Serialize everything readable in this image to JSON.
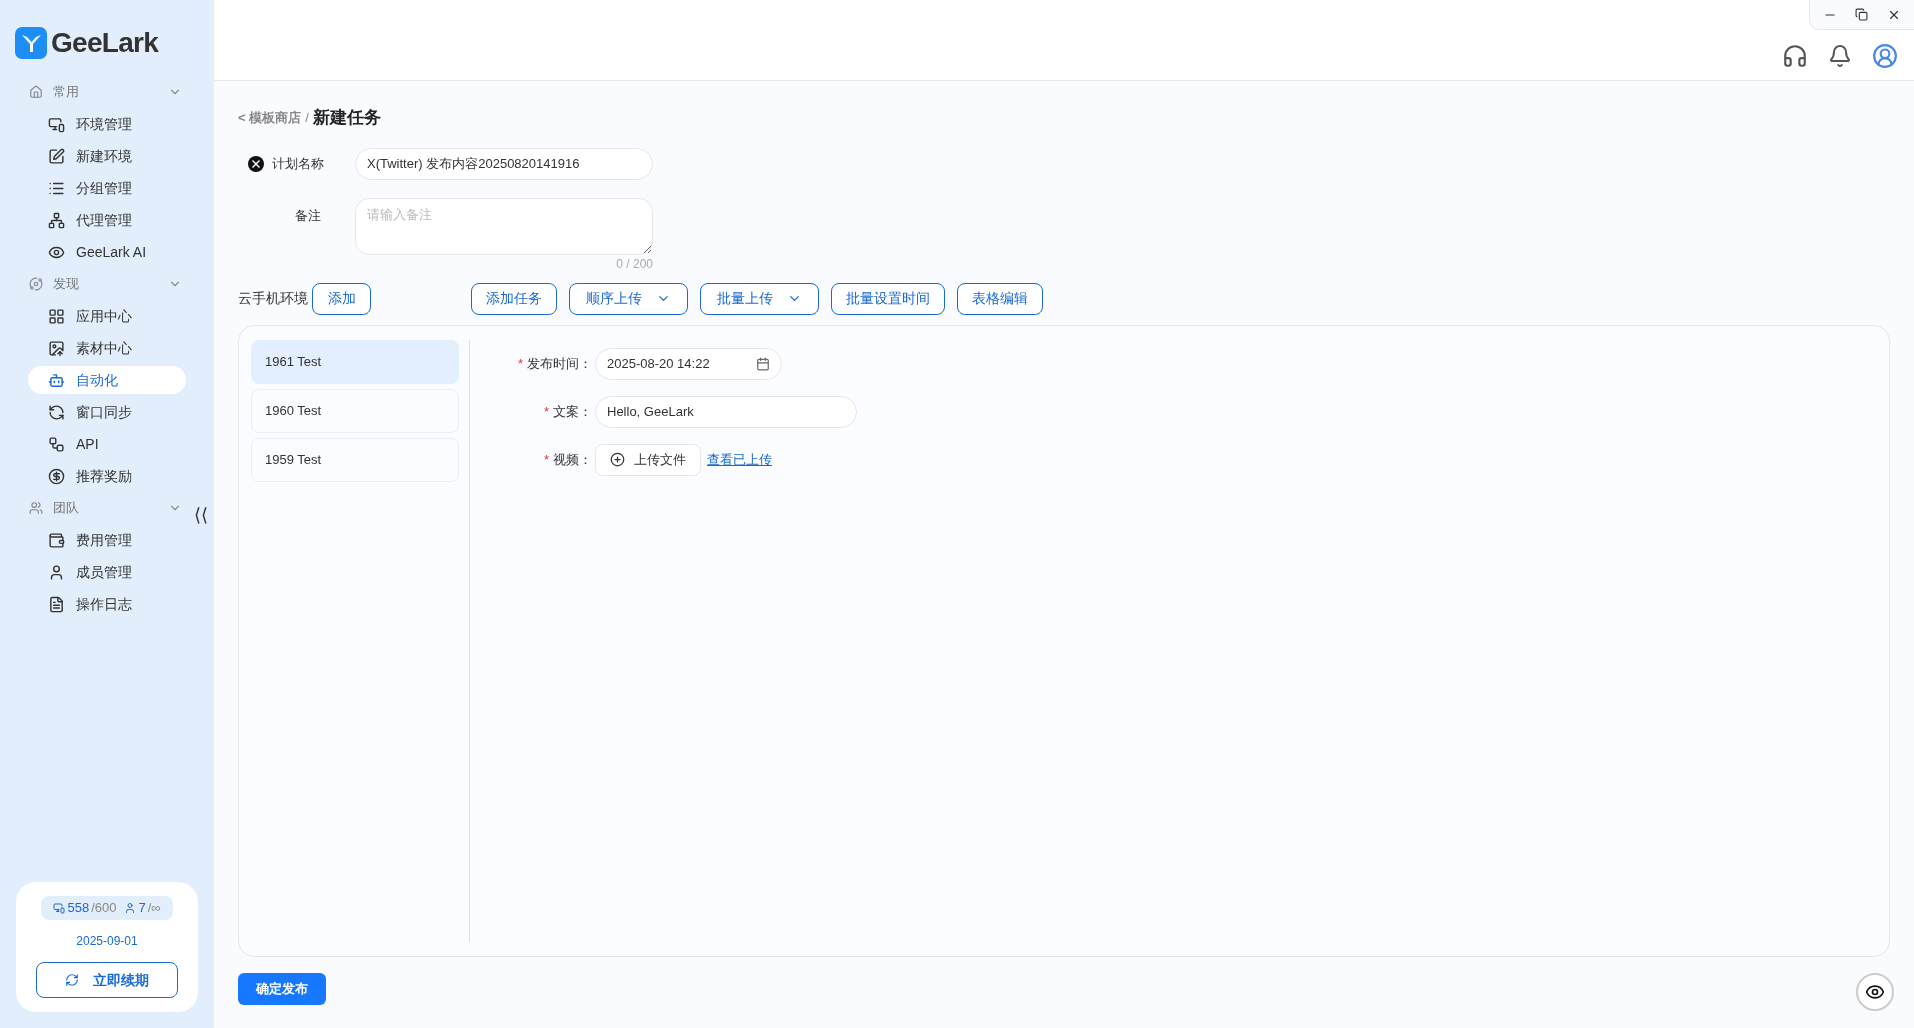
{
  "brand": {
    "name": "GeeLark"
  },
  "sidebar": {
    "sections": [
      {
        "title": "常用",
        "expanded": true,
        "items": [
          {
            "label": "环境管理",
            "selected": false
          },
          {
            "label": "新建环境",
            "selected": false
          },
          {
            "label": "分组管理",
            "selected": false
          },
          {
            "label": "代理管理",
            "selected": false
          },
          {
            "label": "GeeLark AI",
            "selected": false
          }
        ]
      },
      {
        "title": "发现",
        "expanded": true,
        "items": [
          {
            "label": "应用中心",
            "selected": false
          },
          {
            "label": "素材中心",
            "selected": false
          },
          {
            "label": "自动化",
            "selected": true
          },
          {
            "label": "窗口同步",
            "selected": false
          },
          {
            "label": "API",
            "selected": false
          },
          {
            "label": "推荐奖励",
            "selected": false
          }
        ]
      },
      {
        "title": "团队",
        "expanded": true,
        "items": [
          {
            "label": "费用管理",
            "selected": false
          },
          {
            "label": "成员管理",
            "selected": false
          },
          {
            "label": "操作日志",
            "selected": false
          }
        ]
      }
    ],
    "collapse": "⟨⟨",
    "plan": {
      "devices_used": "558",
      "devices_total": "/600",
      "members_used": "7",
      "members_total": "/∞",
      "expiry": "2025-09-01",
      "renew": "立即续期"
    }
  },
  "breadcrumb": {
    "back": "< 模板商店",
    "separator": "/",
    "current": "新建任务"
  },
  "form": {
    "name_label": "计划名称",
    "name_value": "X(Twitter) 发布内容20250820141916",
    "note_label": "备注",
    "note_placeholder": "请输入备注",
    "note_count": "0 / 200"
  },
  "toolbar": {
    "env_label": "云手机环境",
    "add": "添加",
    "buttons": [
      {
        "label": "添加任务",
        "dropdown": false
      },
      {
        "label": "顺序上传",
        "dropdown": true
      },
      {
        "label": "批量上传",
        "dropdown": true
      },
      {
        "label": "批量设置时间",
        "dropdown": false
      },
      {
        "label": "表格编辑",
        "dropdown": false
      }
    ]
  },
  "environments": [
    {
      "label": "1961 Test",
      "selected": true
    },
    {
      "label": "1960 Test",
      "selected": false
    },
    {
      "label": "1959 Test",
      "selected": false
    }
  ],
  "task": {
    "fields": [
      {
        "kind": "datetime",
        "label": "发布时间",
        "required": true,
        "value": "2025-08-20 14:22"
      },
      {
        "kind": "text",
        "label": "文案",
        "required": true,
        "value": "Hello, GeeLark"
      },
      {
        "kind": "upload",
        "label": "视频",
        "required": true,
        "button": "上传文件",
        "link": "查看已上传"
      }
    ],
    "required_mark": "*",
    "colon": "："
  },
  "submit": "确定发布"
}
